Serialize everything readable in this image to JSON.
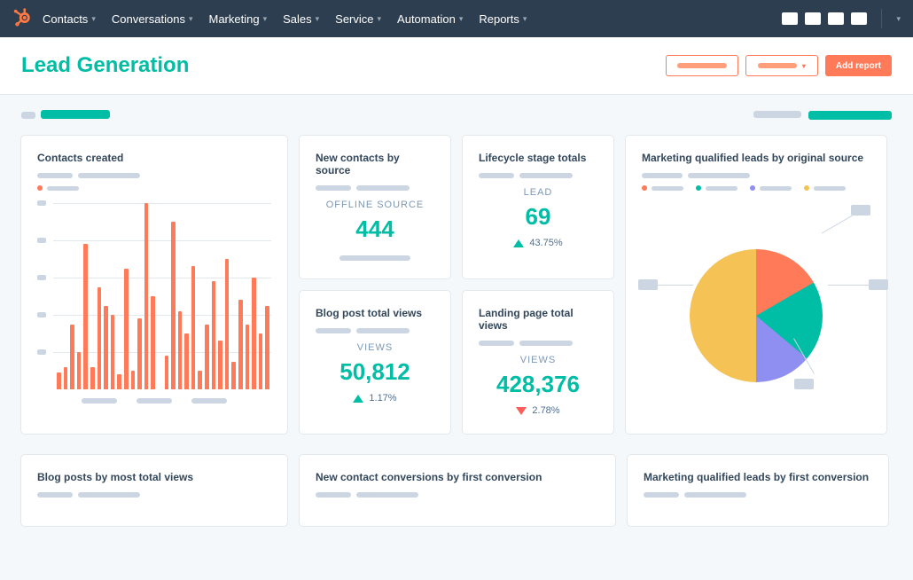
{
  "nav": {
    "items": [
      "Contacts",
      "Conversations",
      "Marketing",
      "Sales",
      "Service",
      "Automation",
      "Reports"
    ]
  },
  "page": {
    "title": "Lead Generation",
    "add_report": "Add report"
  },
  "cards": {
    "contacts": {
      "title": "Contacts created"
    },
    "new_contacts": {
      "title": "New contacts by source",
      "kpi_label": "OFFLINE SOURCE",
      "kpi_value": "444"
    },
    "lifecycle": {
      "title": "Lifecycle stage totals",
      "kpi_label": "LEAD",
      "kpi_value": "69",
      "delta": "43.75%"
    },
    "blog_views": {
      "title": "Blog post total views",
      "kpi_label": "VIEWS",
      "kpi_value": "50,812",
      "delta": "1.17%"
    },
    "lp_views": {
      "title": "Landing page total views",
      "kpi_label": "VIEWS",
      "kpi_value": "428,376",
      "delta": "2.78%"
    },
    "mql_source": {
      "title": "Marketing qualified leads by original source"
    },
    "blog_most": {
      "title": "Blog posts by most total views"
    },
    "conv_first": {
      "title": "New contact conversions by first conversion"
    },
    "mql_first": {
      "title": "Marketing qualified leads by first conversion"
    }
  },
  "chart_data": [
    {
      "type": "bar",
      "title": "Contacts created",
      "values": [
        9,
        12,
        35,
        20,
        78,
        12,
        55,
        45,
        40,
        8,
        65,
        10,
        38,
        100,
        50,
        0,
        18,
        90,
        42,
        30,
        66,
        10,
        35,
        58,
        26,
        70,
        15,
        48,
        35,
        60,
        30,
        45
      ],
      "ylim": [
        0,
        100
      ]
    },
    {
      "type": "pie",
      "title": "Marketing qualified leads by original source",
      "series": [
        {
          "name": "segment-yellow",
          "value": 50,
          "color": "#f5c355"
        },
        {
          "name": "segment-orange",
          "value": 17,
          "color": "#ff7a59"
        },
        {
          "name": "segment-teal",
          "value": 19,
          "color": "#00bda5"
        },
        {
          "name": "segment-purple",
          "value": 14,
          "color": "#8e8ff0"
        }
      ]
    }
  ]
}
